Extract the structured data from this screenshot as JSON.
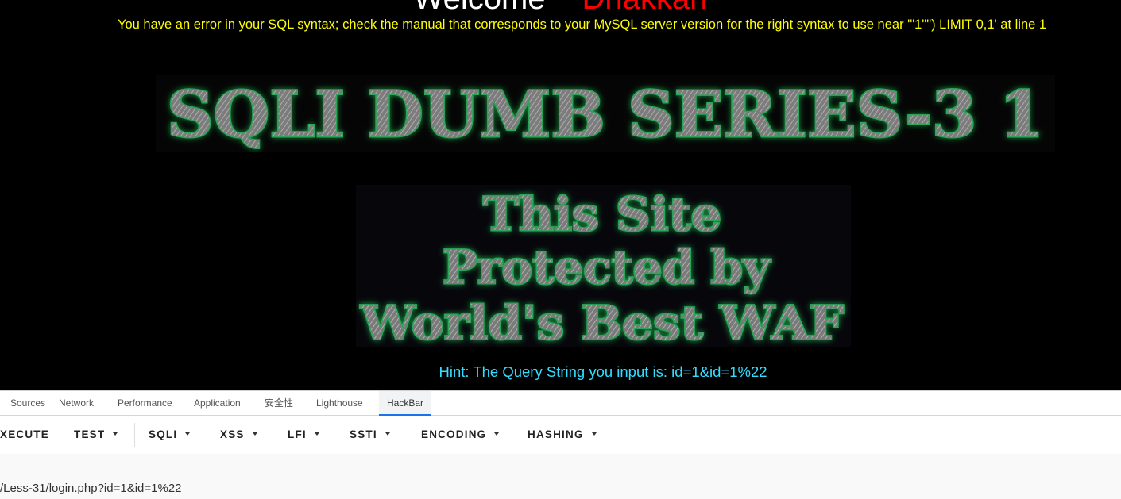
{
  "page": {
    "welcome_text": "Welcome",
    "welcome_user": "Dhakkan",
    "sql_error": "You have an error in your SQL syntax; check the manual that corresponds to your MySQL server version for the right syntax to use near '\"1\"\") LIMIT 0,1' at line 1",
    "banner_title": "SQLI DUMB SERIES-3 1",
    "waf_lines": [
      "This Site",
      "Protected by",
      "World's Best WAF"
    ],
    "hint": "Hint: The Query String you input is: id=1&id=1%22",
    "colors": {
      "error": "#ffff00",
      "user": "#ff0000",
      "hint": "#33ddff",
      "glow": "#22ff66"
    }
  },
  "devtools": {
    "tabs": [
      {
        "label": "Sources"
      },
      {
        "label": "Network"
      },
      {
        "label": "Performance"
      },
      {
        "label": "Application"
      },
      {
        "label": "安全性"
      },
      {
        "label": "Lighthouse"
      },
      {
        "label": "HackBar",
        "active": true
      }
    ]
  },
  "hackbar": {
    "buttons": [
      {
        "label": "XECUTE",
        "dropdown": false
      },
      {
        "label": "TEST",
        "dropdown": true
      },
      {
        "label": "SQLI",
        "dropdown": true
      },
      {
        "label": "XSS",
        "dropdown": true
      },
      {
        "label": "LFI",
        "dropdown": true
      },
      {
        "label": "SSTI",
        "dropdown": true
      },
      {
        "label": "ENCODING",
        "dropdown": true
      },
      {
        "label": "HASHING",
        "dropdown": true
      }
    ],
    "url_value": "/Less-31/login.php?id=1&id=1%22",
    "accent": "#1a73e8"
  }
}
